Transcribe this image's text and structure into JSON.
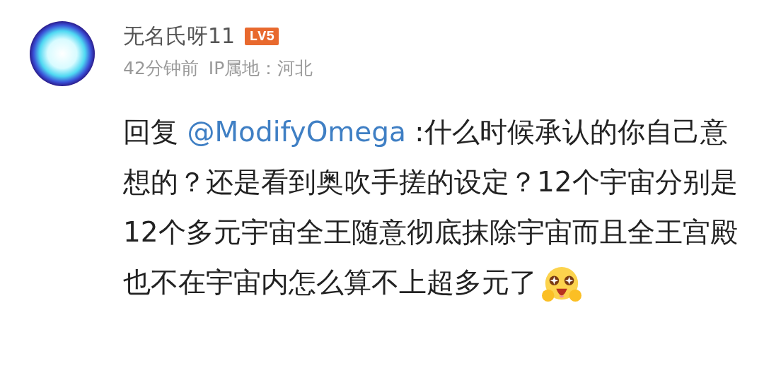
{
  "comment": {
    "username": "无名氏呀11",
    "level_badge": "LV5",
    "time": "42分钟前",
    "ip_location": "IP属地：河北",
    "body": {
      "reply_prefix": "回复",
      "mention": "@ModifyOmega",
      "text": ":什么时候承认的你自己意想的？还是看到奥吹手搓的设定？12个宇宙分别是12个多元宇宙全王随意彻底抹除宇宙而且全王宫殿也不在宇宙内怎么算不上超多元了"
    }
  }
}
